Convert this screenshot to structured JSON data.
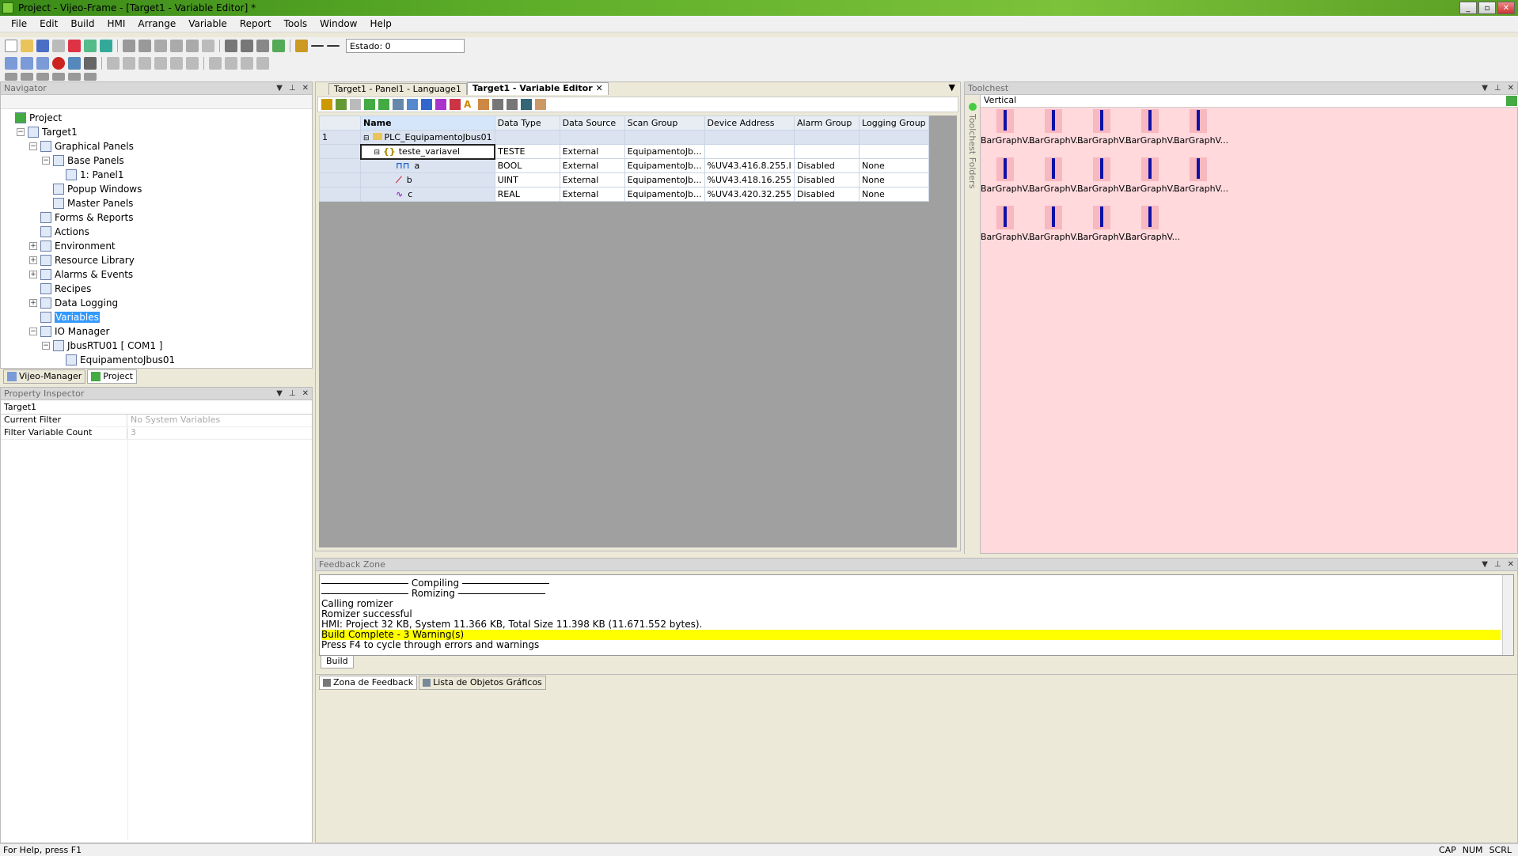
{
  "window": {
    "title": "Project - Vijeo-Frame - [Target1 - Variable Editor] *"
  },
  "menu": [
    "File",
    "Edit",
    "Build",
    "HMI",
    "Arrange",
    "Variable",
    "Report",
    "Tools",
    "Window",
    "Help"
  ],
  "toolbar": {
    "state_label": "Estado: 0"
  },
  "navigator": {
    "title": "Navigator",
    "tree": [
      {
        "label": "Project",
        "level": 0,
        "exp": ""
      },
      {
        "label": "Target1",
        "level": 1,
        "exp": "−"
      },
      {
        "label": "Graphical Panels",
        "level": 2,
        "exp": "−"
      },
      {
        "label": "Base Panels",
        "level": 3,
        "exp": "−"
      },
      {
        "label": "1: Panel1",
        "level": 4,
        "exp": ""
      },
      {
        "label": "Popup Windows",
        "level": 3,
        "exp": ""
      },
      {
        "label": "Master Panels",
        "level": 3,
        "exp": ""
      },
      {
        "label": "Forms & Reports",
        "level": 2,
        "exp": ""
      },
      {
        "label": "Actions",
        "level": 2,
        "exp": ""
      },
      {
        "label": "Environment",
        "level": 2,
        "exp": "+"
      },
      {
        "label": "Resource Library",
        "level": 2,
        "exp": "+"
      },
      {
        "label": "Alarms & Events",
        "level": 2,
        "exp": "+"
      },
      {
        "label": "Recipes",
        "level": 2,
        "exp": ""
      },
      {
        "label": "Data Logging",
        "level": 2,
        "exp": "+"
      },
      {
        "label": "Variables",
        "level": 2,
        "exp": "",
        "selected": true
      },
      {
        "label": "IO Manager",
        "level": 2,
        "exp": "−"
      },
      {
        "label": "JbusRTU01 [ COM1 ]",
        "level": 3,
        "exp": "−"
      },
      {
        "label": "EquipamentoJbus01",
        "level": 4,
        "exp": ""
      }
    ],
    "tabs": [
      "Vijeo-Manager",
      "Project"
    ]
  },
  "inspector": {
    "title": "Property Inspector",
    "object": "Target1",
    "rows": [
      {
        "name": "Current Filter",
        "value": "No System Variables"
      },
      {
        "name": "Filter Variable Count",
        "value": "3"
      }
    ]
  },
  "editor": {
    "tabs": [
      "Target1 - Panel1 - Language1",
      "Target1 - Variable Editor"
    ],
    "columns": [
      "Name",
      "Data Type",
      "Data Source",
      "Scan Group",
      "Device Address",
      "Alarm Group",
      "Logging Group"
    ],
    "rows": [
      {
        "num": "1",
        "name": "PLC_EquipamentoJbus01",
        "type": "",
        "source": "",
        "scan": "",
        "addr": "",
        "alarm": "",
        "log": ""
      },
      {
        "num": "",
        "name": "teste_variavel",
        "type": "TESTE",
        "source": "External",
        "scan": "EquipamentoJb...",
        "addr": "",
        "alarm": "",
        "log": ""
      },
      {
        "num": "",
        "name": "a",
        "type": "BOOL",
        "source": "External",
        "scan": "EquipamentoJb...",
        "addr": "%UV43.416.8.255.I",
        "alarm": "Disabled",
        "log": "None"
      },
      {
        "num": "",
        "name": "b",
        "type": "UINT",
        "source": "External",
        "scan": "EquipamentoJb...",
        "addr": "%UV43.418.16.255",
        "alarm": "Disabled",
        "log": "None"
      },
      {
        "num": "",
        "name": "c",
        "type": "REAL",
        "source": "External",
        "scan": "EquipamentoJb...",
        "addr": "%UV43.420.32.255",
        "alarm": "Disabled",
        "log": "None"
      }
    ]
  },
  "toolchest": {
    "title": "Toolchest",
    "folders_label": "Toolchest Folders",
    "category": "Vertical",
    "items": [
      "BarGraphV...",
      "BarGraphV...",
      "BarGraphV...",
      "BarGraphV...",
      "BarGraphV...",
      "BarGraphV...",
      "BarGraphV...",
      "BarGraphV...",
      "BarGraphV...",
      "BarGraphV...",
      "BarGraphV...",
      "BarGraphV...",
      "BarGraphV...",
      "BarGraphV..."
    ]
  },
  "feedback": {
    "title": "Feedback Zone",
    "compiling": "Compiling",
    "romizing": "Romizing",
    "lines": [
      "Calling romizer",
      "Romizer successful",
      "HMI: Project 32 KB, System 11.366 KB, Total Size 11.398 KB (11.671.552 bytes)."
    ],
    "highlight": "Build Complete - 3 Warning(s)",
    "last": "Press F4 to cycle through errors and warnings",
    "inner_tab": "Build",
    "bottom_tabs": [
      "Zona de Feedback",
      "Lista de Objetos Gráficos"
    ]
  },
  "status": {
    "help": "For Help, press F1",
    "cap": "CAP",
    "num": "NUM",
    "scrl": "SCRL"
  },
  "colors": {
    "selection": "#3399ff",
    "highlight": "#ffff00",
    "toolchest_bg": "#ffd9dc"
  }
}
